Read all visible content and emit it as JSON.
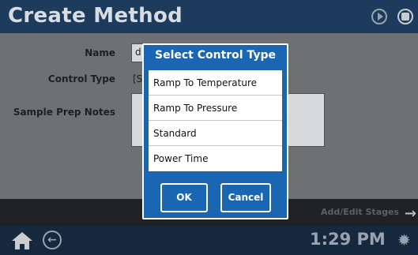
{
  "header": {
    "title": "Create Method"
  },
  "form": {
    "name_label": "Name",
    "name_value": "d",
    "control_type_label": "Control Type",
    "control_type_value": "[S",
    "notes_label": "Sample Prep Notes"
  },
  "dialog": {
    "title": "Select Control Type",
    "options": [
      "Ramp To Temperature",
      "Ramp To Pressure",
      "Standard",
      "Power Time"
    ],
    "ok_label": "OK",
    "cancel_label": "Cancel"
  },
  "stage_bar": {
    "label": "Add/Edit Stages"
  },
  "footer": {
    "time": "1:29 PM"
  },
  "colors": {
    "header": "#1d3b5c",
    "dialog": "#1a66b3",
    "footer": "#15283d"
  },
  "icons": [
    "play-icon",
    "save-icon",
    "arrow-right-icon",
    "home-icon",
    "back-icon",
    "gear-icon"
  ]
}
